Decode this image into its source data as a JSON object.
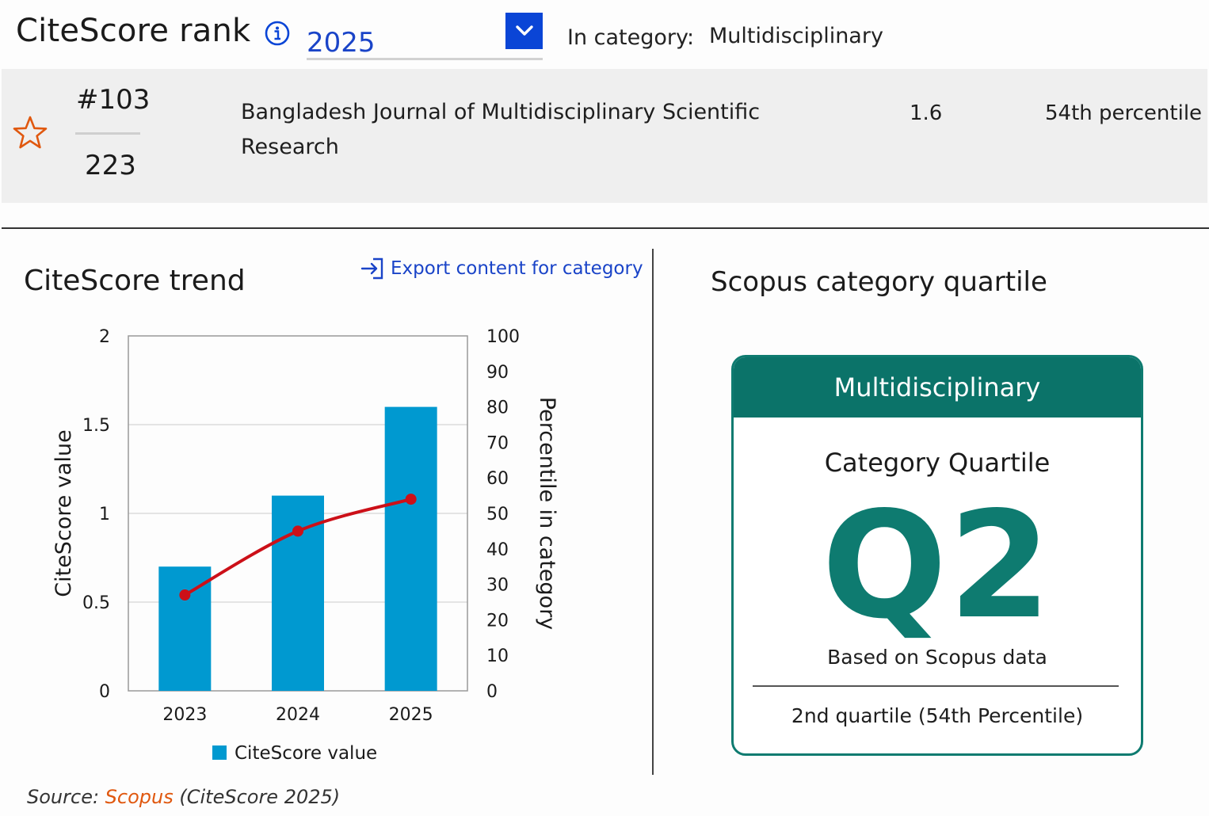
{
  "header": {
    "title": "CiteScore rank",
    "year": "2025",
    "category_label": "In category:",
    "category_value": "Multidisciplinary"
  },
  "rank_row": {
    "rank": "#103",
    "total": "223",
    "journal": "Bangladesh Journal of Multidisciplinary Scientific Research",
    "score": "1.6",
    "percentile": "54th percentile"
  },
  "trend": {
    "title": "CiteScore trend",
    "export_label": "Export content for category",
    "legend_label": "CiteScore value",
    "source_prefix": "Source: ",
    "source_name": "Scopus",
    "source_suffix": " (CiteScore 2025)"
  },
  "quartile": {
    "title": "Scopus category quartile",
    "category": "Multidisciplinary",
    "label": "Category Quartile",
    "value": "Q2",
    "based_on": "Based on Scopus data",
    "description": "2nd quartile (54th Percentile)"
  },
  "colors": {
    "accent_blue": "#0a45d6",
    "bar_blue": "#0099d0",
    "line_red": "#cc1018",
    "quartile_teal": "#0b7369",
    "star_orange": "#e0580f"
  },
  "icons": {
    "info": "info-icon",
    "dropdown": "chevron-down-icon",
    "star": "star-icon",
    "export": "export-icon"
  },
  "chart_data": {
    "type": "bar",
    "categories": [
      "2023",
      "2024",
      "2025"
    ],
    "series": [
      {
        "name": "CiteScore value",
        "type": "bar",
        "axis": "left",
        "values": [
          0.7,
          1.1,
          1.6
        ]
      },
      {
        "type": "line",
        "axis": "right",
        "values": [
          27,
          45,
          54
        ]
      }
    ],
    "ylabel": "CiteScore value",
    "ylim": [
      0,
      2
    ],
    "yticks": [
      "0",
      "0.5",
      "1",
      "1.5",
      "2"
    ],
    "y2label": "Percentile in category",
    "y2lim": [
      0,
      100
    ],
    "y2ticks": [
      "0",
      "10",
      "20",
      "30",
      "40",
      "50",
      "60",
      "70",
      "80",
      "90",
      "100"
    ],
    "grid": true,
    "legend": "bottom"
  }
}
